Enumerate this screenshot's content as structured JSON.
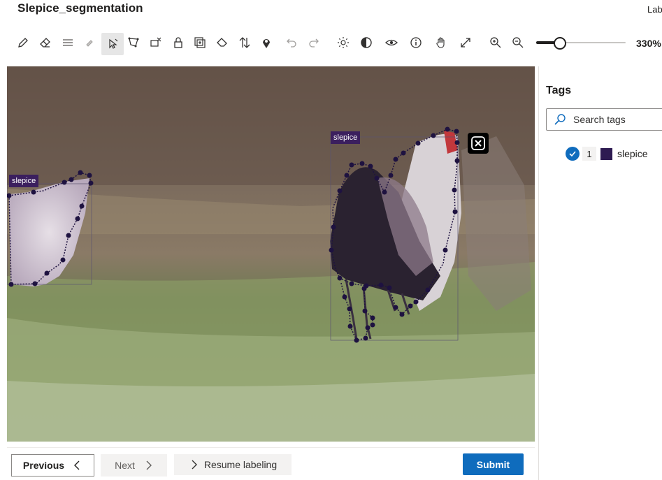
{
  "app": {
    "title": "Slepice_segmentation",
    "corner_text": "Lab"
  },
  "toolbar": {
    "tools": [
      {
        "name": "pencil-tool",
        "icon": "pencil-icon"
      },
      {
        "name": "eraser-tool",
        "icon": "eraser-icon"
      },
      {
        "name": "line-thickness-tool",
        "icon": "line-weight-icon"
      },
      {
        "name": "small-eraser-tool",
        "icon": "eraser-small-icon"
      },
      {
        "name": "select-tool",
        "icon": "cursor-icon",
        "active": true
      },
      {
        "name": "polygon-tool",
        "icon": "polygon-icon"
      },
      {
        "name": "bbox-remove-tool",
        "icon": "box-remove-icon"
      },
      {
        "name": "lock-tool",
        "icon": "lock-icon"
      },
      {
        "name": "copy-region-tool",
        "icon": "copy-region-icon"
      },
      {
        "name": "fill-tool",
        "icon": "eraser-fill-icon"
      },
      {
        "name": "sort-tool",
        "icon": "sort-arrows-icon"
      },
      {
        "name": "pin-tool",
        "icon": "location-pin-icon"
      },
      {
        "name": "undo-tool",
        "icon": "undo-icon"
      },
      {
        "name": "redo-tool",
        "icon": "redo-icon"
      },
      {
        "name": "brightness-tool",
        "icon": "sun-icon"
      },
      {
        "name": "contrast-tool",
        "icon": "contrast-icon"
      },
      {
        "name": "visibility-tool",
        "icon": "eye-icon"
      },
      {
        "name": "info-tool",
        "icon": "info-icon"
      },
      {
        "name": "pan-tool",
        "icon": "hand-icon"
      },
      {
        "name": "fit-tool",
        "icon": "expand-icon"
      },
      {
        "name": "zoom-in-tool",
        "icon": "zoom-in-icon"
      },
      {
        "name": "zoom-out-tool",
        "icon": "zoom-out-icon"
      }
    ],
    "zoom": {
      "value_label": "330%",
      "slider_fraction": 0.26
    }
  },
  "canvas": {
    "annotations": [
      {
        "label": "slepice",
        "color": "#3b1f5e"
      },
      {
        "label": "slepice",
        "color": "#3b1f5e"
      }
    ]
  },
  "sidebar": {
    "title": "Tags",
    "search_placeholder": "Search tags",
    "tags": [
      {
        "index": "1",
        "name": "slepice",
        "color": "#2e1b52",
        "checked": true
      }
    ]
  },
  "footer": {
    "previous_label": "Previous",
    "next_label": "Next",
    "resume_label": "Resume labeling",
    "submit_label": "Submit"
  },
  "colors": {
    "accent": "#0f6cbd",
    "annotation": "#2e1b52"
  }
}
